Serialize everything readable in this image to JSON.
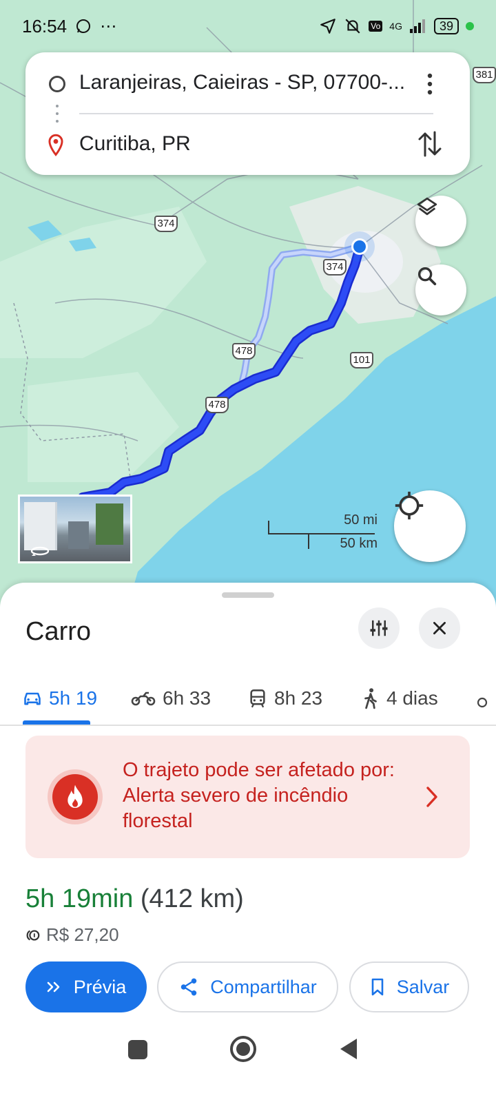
{
  "status_bar": {
    "time": "16:54",
    "battery": "39",
    "network": "4G"
  },
  "route": {
    "origin": "Laranjeiras, Caieiras - SP, 07700-...",
    "destination": "Curitiba, PR"
  },
  "map": {
    "road_labels": [
      "374",
      "374",
      "478",
      "478",
      "101",
      "381"
    ],
    "scale_mi": "50 mi",
    "scale_km": "50 km"
  },
  "sheet": {
    "title": "Carro",
    "tabs": [
      {
        "label": "5h 19",
        "icon": "car-icon"
      },
      {
        "label": "6h 33",
        "icon": "motorcycle-icon"
      },
      {
        "label": "8h 23",
        "icon": "transit-icon"
      },
      {
        "label": "4 dias",
        "icon": "walking-icon"
      }
    ],
    "alert": {
      "text": "O trajeto pode ser afetado por: Alerta severo de incêndio florestal"
    },
    "duration": "5h 19min",
    "distance": "(412 km)",
    "toll": "R$ 27,20",
    "actions": {
      "preview": "Prévia",
      "share": "Compartilhar",
      "save": "Salvar"
    }
  },
  "colors": {
    "accent": "#1a73e8",
    "route": "#1a3ef0",
    "alert_bg": "#fbe8e7",
    "alert_text": "#c5221f",
    "duration_green": "#188038",
    "water": "#7fd3ea",
    "land": "#bfe8d2"
  }
}
